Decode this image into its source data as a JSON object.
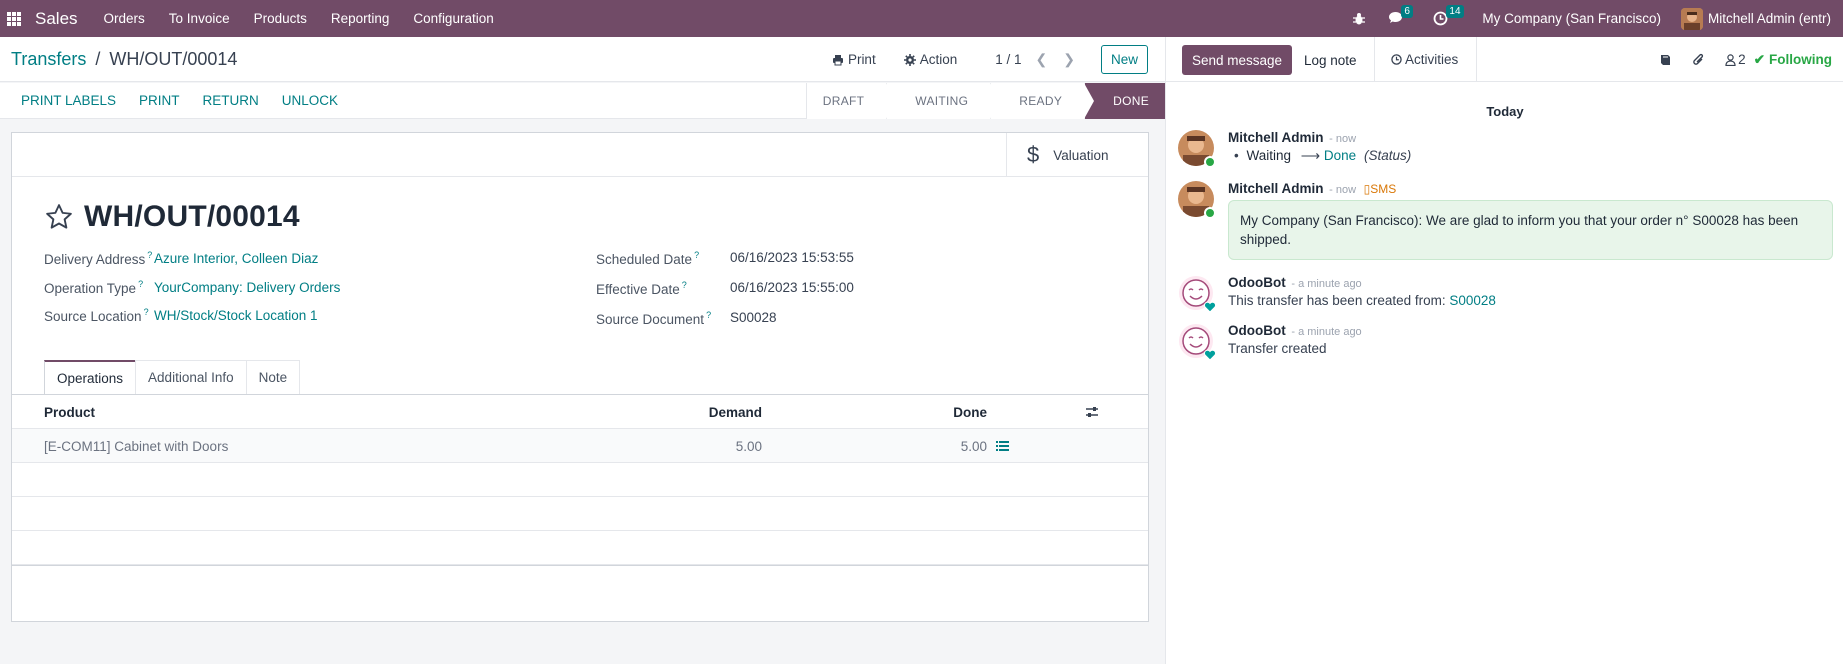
{
  "navbar": {
    "app_name": "Sales",
    "menus": [
      "Orders",
      "To Invoice",
      "Products",
      "Reporting",
      "Configuration"
    ],
    "messages_count": "6",
    "activities_count": "14",
    "company": "My Company (San Francisco)",
    "user": "Mitchell Admin (entr)"
  },
  "control_panel": {
    "breadcrumb_parent": "Transfers",
    "breadcrumb_sep": "/",
    "breadcrumb_current": "WH/OUT/00014",
    "print_label": "Print",
    "action_label": "Action",
    "pager": "1 / 1",
    "new_label": "New"
  },
  "statusbar": {
    "buttons": [
      "PRINT LABELS",
      "PRINT",
      "RETURN",
      "UNLOCK"
    ],
    "stages": [
      "DRAFT",
      "WAITING",
      "READY",
      "DONE"
    ],
    "active_stage": "DONE"
  },
  "form": {
    "valuation_label": "Valuation",
    "title": "WH/OUT/00014",
    "fields_left": [
      {
        "label": "Delivery Address",
        "value": "Azure Interior, Colleen Diaz"
      },
      {
        "label": "Operation Type",
        "value": "YourCompany: Delivery Orders"
      },
      {
        "label": "Source Location",
        "value": "WH/Stock/Stock Location 1"
      }
    ],
    "fields_right": [
      {
        "label": "Scheduled Date",
        "value": "06/16/2023 15:53:55"
      },
      {
        "label": "Effective Date",
        "value": "06/16/2023 15:55:00"
      },
      {
        "label": "Source Document",
        "value": "S00028"
      }
    ],
    "help_mark": "?",
    "tabs": [
      "Operations",
      "Additional Info",
      "Note"
    ],
    "table": {
      "headers": [
        "Product",
        "Demand",
        "Done"
      ],
      "rows": [
        {
          "product": "[E-COM11] Cabinet with Doors",
          "demand": "5.00",
          "done": "5.00"
        }
      ]
    }
  },
  "chatter": {
    "send_message": "Send message",
    "log_note": "Log note",
    "activities": "Activities",
    "followers_count": "2",
    "following": "Following",
    "day_separator": "Today",
    "messages": [
      {
        "author": "Mitchell Admin",
        "time": "- now",
        "from": "Waiting",
        "to": "Done",
        "field": "(Status)"
      },
      {
        "author": "Mitchell Admin",
        "time": "- now",
        "tag": "SMS",
        "text": "My Company (San Francisco): We are glad to inform you that your order n° S00028 has been shipped."
      },
      {
        "author": "OdooBot",
        "time": "- a minute ago",
        "text": "This transfer has been created from:",
        "link": "S00028"
      },
      {
        "author": "OdooBot",
        "time": "- a minute ago",
        "text": "Transfer created"
      }
    ]
  },
  "colors": {
    "brand": "#714B67",
    "link": "#017e84",
    "following": "#28a745",
    "sms": "#d97706"
  }
}
